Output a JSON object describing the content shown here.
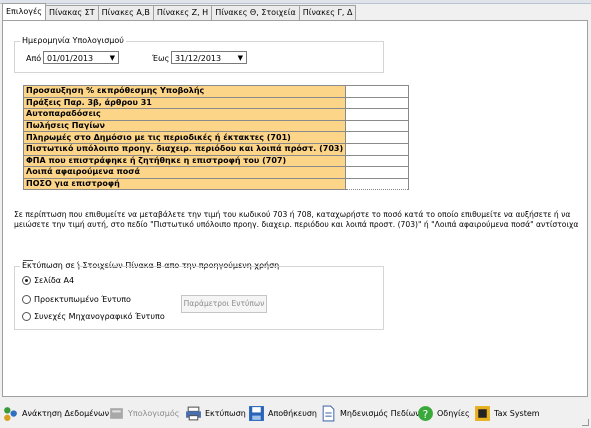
{
  "tabs": [
    {
      "label": "Επιλογές"
    },
    {
      "label": "Πίνακας ΣΤ"
    },
    {
      "label": "Πίνακες Α,Β"
    },
    {
      "label": "Πίνακες Ζ, Η"
    },
    {
      "label": "Πίνακες Θ, Στοιχεία"
    },
    {
      "label": "Πίνακες Γ, Δ"
    }
  ],
  "date_group": {
    "legend": "Ημερομηνία Υπολογισμού",
    "from_label": "Από",
    "from_value": "01/01/2013",
    "to_label": "Έως",
    "to_value": "31/12/2013"
  },
  "table_rows": [
    {
      "label": "Προσαυξηση % εκπρόθεσμης Υποβολής",
      "value": ""
    },
    {
      "label": "Πράξεις Παρ. 3β, άρθρου 31",
      "value": ""
    },
    {
      "label": "Αυτοπαραδόσεις",
      "value": ""
    },
    {
      "label": "Πωλήσεις Παγίων",
      "value": ""
    },
    {
      "label": "Πληρωμές στο Δημόσιο με τις περιοδικές ή έκτακτες (701)",
      "value": ""
    },
    {
      "label": "Πιστωτικό υπόλοιπο προηγ. διαχειρ. περιόδου και λοιπά πρόστ. (703)",
      "value": ""
    },
    {
      "label": "ΦΠΑ που επιστράφηκε ή ζητήθηκε η επιστροφή του (707)",
      "value": ""
    },
    {
      "label": "Λοιπά αφαιρούμενα ποσά",
      "value": ""
    },
    {
      "label": "ΠΟΣΟ για επιστροφή",
      "value": ""
    }
  ],
  "note": "Σε περίπτωση που επιθυμείτε να μεταβάλετε την τιμή του κωδικού 703 ή 708, καταχωρήστε το ποσό κατά το οποίο επιθυμείτε να αυξήσετε ή να μειώσετε την τιμή αυτή, στο πεδίο \"Πιστωτικό υπόλοιπο προηγ. διαχειρ. περιόδου και λοιπά προστ. (703)\" ή \"Λοιπά αφαιρούμενα ποσά\" αντίστοιχα",
  "copy_checkbox": {
    "label": "Αντιγραφή Στοιχείων Πίνακα Β απο την προηγούμενη χρήση",
    "checked": false
  },
  "print_group": {
    "legend": "Εκτύπωση σε",
    "options": [
      {
        "label": "Σελίδα A4",
        "selected": true
      },
      {
        "label": "Προεκτυπωμένο Έντυπο",
        "selected": false
      },
      {
        "label": "Συνεχές Μηχανογραφικό Έντυπο",
        "selected": false
      }
    ],
    "params_button": "Παράμετροι Εντύπων"
  },
  "toolbar": {
    "load": "Ανάκτηση Δεδομένων",
    "calc": "Υπολογισμός",
    "print": "Εκτύπωση",
    "save": "Αποθήκευση",
    "clear": "Μηδενισμός Πεδίων",
    "help": "Οδηγίες",
    "tax": "Tax System"
  },
  "colors": {
    "label_cell": "#fdd589",
    "window_bg": "#f0f0f0"
  }
}
